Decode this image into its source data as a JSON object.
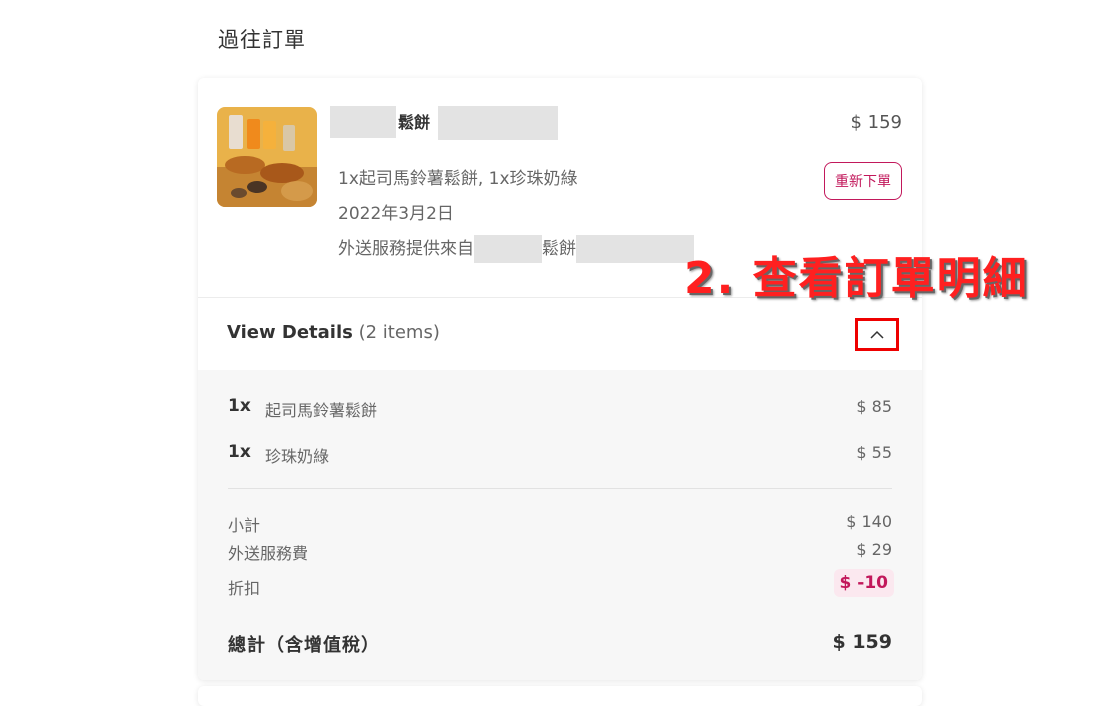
{
  "page": {
    "title": "過往訂單"
  },
  "order": {
    "restaurant_visible_text": "鬆餅",
    "price": "$ 159",
    "items_summary": "1x起司馬鈴薯鬆餅, 1x珍珠奶綠",
    "date": "2022年3月2日",
    "delivery_prefix": "外送服務提供來自",
    "delivery_suffix": "鬆餅",
    "reorder_label": "重新下單"
  },
  "details": {
    "label": "View Details",
    "count": "(2 items)",
    "toggle_icon": "chevron-up-icon",
    "items": [
      {
        "qty": "1x",
        "name": "起司馬鈴薯鬆餅",
        "price": "$ 85"
      },
      {
        "qty": "1x",
        "name": "珍珠奶綠",
        "price": "$ 55"
      }
    ],
    "subtotal_label": "小計",
    "subtotal_value": "$ 140",
    "delivery_fee_label": "外送服務費",
    "delivery_fee_value": "$ 29",
    "discount_label": "折扣",
    "discount_value": "$ -10",
    "total_label": "總計（含增值稅）",
    "total_value": "$ 159"
  },
  "annotation": {
    "text": "2. 查看訂單明細",
    "color": "#ff2020"
  },
  "colors": {
    "accent": "#c2185b",
    "highlight_box": "#ee0000"
  }
}
